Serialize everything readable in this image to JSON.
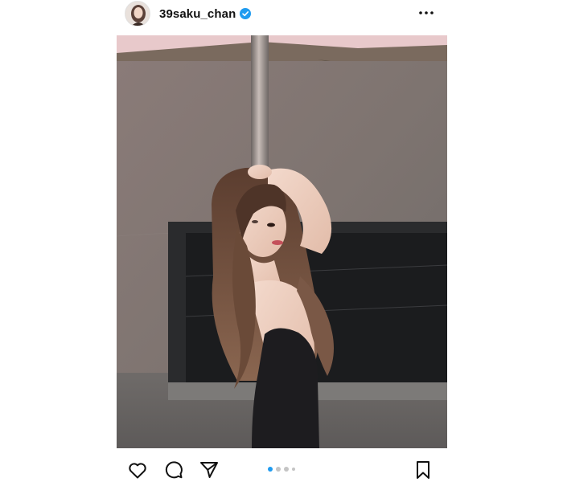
{
  "post": {
    "username": "39saku_chan",
    "verified_icon": "verified-badge-icon",
    "avatar_icon": "profile-avatar",
    "more_icon": "more-options-icon"
  },
  "actions": {
    "like_icon": "heart-icon",
    "comment_icon": "comment-icon",
    "share_icon": "send-icon",
    "save_icon": "bookmark-icon"
  },
  "carousel": {
    "slide_count": 4,
    "active_index": 0
  },
  "colors": {
    "accent": "#1f9bf0",
    "verified": "#1f9bf0",
    "inactive_dot": "#c4c4c4",
    "text": "#111111"
  }
}
